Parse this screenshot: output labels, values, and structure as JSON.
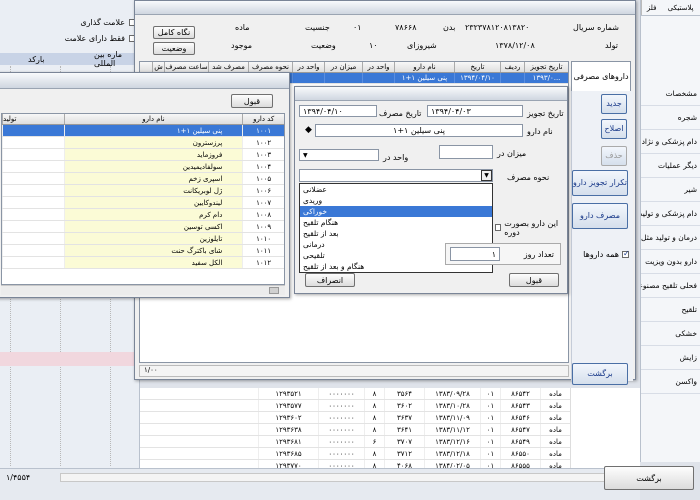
{
  "left_panel": {
    "chk_mark_label": "علامت گذاری",
    "chk_only_marked_label": "فقط دارای علامت",
    "barcode_label": "بارکد",
    "intl_number_label": "ماره بین المللی"
  },
  "right_panel": {
    "top_tabs": [
      "پلاستیکی",
      "فلز"
    ],
    "items": [
      "مشخصات",
      "شجره",
      "دام پزشکی و نژاد",
      "دیگر عملیات",
      "شیر",
      "دام پزشکی و تولید",
      "درمان و تولید مثل",
      "دارو بدون ویزیت",
      "فحلی تلقیح مصنوعی",
      "تلقیح",
      "خشکی",
      "زایش",
      "واکسن"
    ]
  },
  "background_grid": {
    "rows": [
      {
        "c1": "ماده",
        "c2": "۸۶۵۴۲",
        "c3": "۰۱",
        "c4": "۱۳۸۳/۰۹/۲۸",
        "c5": "۳۵۶۴",
        "c6": "۸",
        "c7": "۰۰۰۰۰۰۰",
        "c8": "۱۲۹۳۵۲۱"
      },
      {
        "c1": "ماده",
        "c2": "۸۶۵۴۳",
        "c3": "۰۱",
        "c4": "۱۳۸۳/۱۰/۲۸",
        "c5": "۳۶۰۲",
        "c6": "۸",
        "c7": "۰۰۰۰۰۰۰",
        "c8": "۱۲۹۳۵۷۷"
      },
      {
        "c1": "ماده",
        "c2": "۸۶۵۴۶",
        "c3": "۰۱",
        "c4": "۱۳۸۳/۱۱/۰۹",
        "c5": "۳۶۳۷",
        "c6": "۸",
        "c7": "۰۰۰۰۰۰۰",
        "c8": "۱۲۹۳۶۰۲"
      },
      {
        "c1": "ماده",
        "c2": "۸۶۵۴۷",
        "c3": "۰۱",
        "c4": "۱۳۸۳/۱۱/۱۲",
        "c5": "۳۶۴۱",
        "c6": "۸",
        "c7": "۰۰۰۰۰۰۰",
        "c8": "۱۲۹۳۶۳۸"
      },
      {
        "c1": "ماده",
        "c2": "۸۶۵۴۹",
        "c3": "۰۱",
        "c4": "۱۳۸۳/۱۲/۱۶",
        "c5": "۳۷۰۷",
        "c6": "۶",
        "c7": "۰۰۰۰۰۰۰",
        "c8": "۱۲۹۳۶۸۱"
      },
      {
        "c1": "ماده",
        "c2": "۸۶۵۵۰",
        "c3": "۰۱",
        "c4": "۱۳۸۳/۱۲/۱۸",
        "c5": "۳۷۱۲",
        "c6": "۸",
        "c7": "۰۰۰۰۰۰۰",
        "c8": "۱۲۹۳۶۸۵"
      },
      {
        "c1": "ماده",
        "c2": "۸۶۵۵۵",
        "c3": "۰۱",
        "c4": "۱۳۸۴/۰۲/۰۵",
        "c5": "۴۰۶۸",
        "c6": "۸",
        "c7": "۰۰۰۰۰۰۰",
        "c8": "۱۲۹۳۷۷۰"
      }
    ],
    "record_counter": "۱/۴۵۵۴",
    "return_button": "برگشت"
  },
  "main_window": {
    "header": {
      "serial_label": "شماره سریال",
      "serial_value": "۲۳۲۳۷۸۱۲۰۸۱۳۸۲۰",
      "body_label": "بدن",
      "body_value": "۷۸۶۶۸",
      "sex_label": "جنسیت",
      "sex_value": "ماده",
      "sex_code": "۰۱",
      "birth_label": "تولد",
      "birth_value": "۱۳۷۸/۱۲/۰۸",
      "milk_label": "شیروزای",
      "milk_value": "۱۰",
      "status_label": "وضعیت",
      "status_value": "موجود",
      "view_full_button": "نگاه کامل",
      "status_button": "وضعیت"
    },
    "tab_label": "داروهای مصرفی",
    "grid_headers": [
      "تاریخ تجویز",
      "ردیف",
      "تاریخ",
      "نام دارو",
      "واحد در",
      "میزان در",
      "واحد در",
      "نحوه مصرف",
      "مصرف شد",
      "ساعت مصرف",
      "ش"
    ],
    "grid_row": [
      "۱۳۹۳/۰...",
      "",
      "۱۳۹۴/۰۴/۱۰",
      "پنی سیلین ۱+۱",
      "",
      "",
      "",
      "",
      "",
      "",
      ""
    ],
    "side_buttons": {
      "new": "جدید",
      "edit": "اصلاح",
      "delete": "حذف",
      "repeat": "تکرار تجویز دارو",
      "consume": "مصرف دارو",
      "all_drugs": "همه داروها",
      "return": "برگشت"
    },
    "record_counter": "۱/۰۰"
  },
  "form_dialog": {
    "prescribe_date_label": "تاریخ تجویز",
    "prescribe_date_value": "۱۳۹۴/۰۴/۰۳",
    "consume_date_label": "تاریخ مصرف",
    "consume_date_value": "۱۳۹۴/۰۴/۱۰",
    "drug_name_label": "نام دارو",
    "drug_name_value": "پنی سیلین ۱+۱",
    "amount_label": "میزان در",
    "unit_label": "واحد در",
    "method_label": "نحوه مصرف",
    "method_options": [
      "عضلانی",
      "وریدی",
      "خوراکی",
      "هنگام تلقیح",
      "بعد از تلقیح",
      "درمانی",
      "تلقیحی",
      "هنگام و بعد از تلقیح"
    ],
    "method_selected_index": 2,
    "checkbox_label": "این دارو بصورت دوره",
    "days_label": "تعداد روز",
    "days_value": "۱",
    "ok_button": "قبول",
    "cancel_button": "انصراف"
  },
  "drug_lookup": {
    "ok_button": "قبول",
    "col_code": "کد دارو",
    "col_name": "نام دارو",
    "col_extra": "تولید",
    "rows": [
      {
        "code": "۱۰۰۱",
        "name": "پنی سیلین ۱+۱"
      },
      {
        "code": "۱۰۰۲",
        "name": "پرزسترون"
      },
      {
        "code": "۱۰۰۳",
        "name": "فروزماید"
      },
      {
        "code": "۱۰۰۴",
        "name": "سولفادیمیدین"
      },
      {
        "code": "۱۰۰۵",
        "name": "اسپری زخم"
      },
      {
        "code": "۱۰۰۶",
        "name": "ژل لوبریکانت"
      },
      {
        "code": "۱۰۰۷",
        "name": "لیندوکایین"
      },
      {
        "code": "۱۰۰۸",
        "name": "دام کرم"
      },
      {
        "code": "۱۰۰۹",
        "name": "اکسی توسین"
      },
      {
        "code": "۱۰۱۰",
        "name": "تایلوزین"
      },
      {
        "code": "۱۰۱۱",
        "name": "شای باکترگ حنت"
      },
      {
        "code": "۱۰۱۲",
        "name": "الکل سفید"
      }
    ]
  },
  "colors": {
    "selection": "#3a78d6",
    "yellow_cell": "#fbfbd6",
    "blue_button_text": "#1a3a8a"
  }
}
